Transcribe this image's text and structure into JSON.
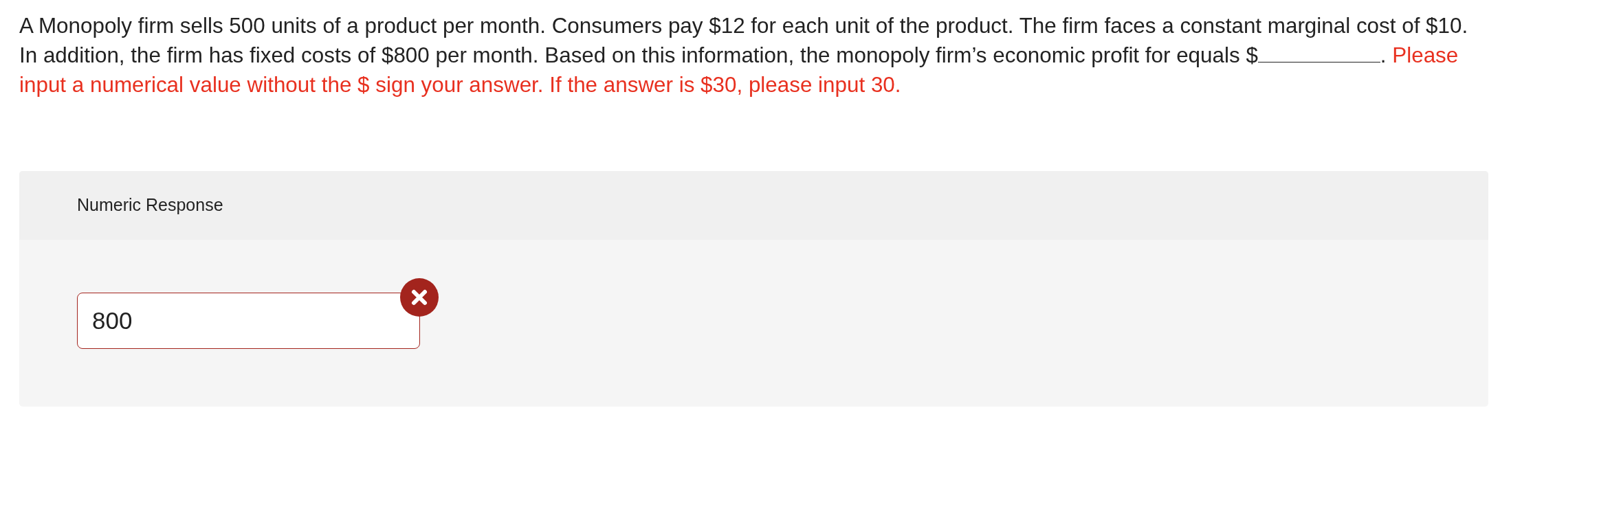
{
  "question": {
    "segments": [
      {
        "kind": "text",
        "text": "A Monopoly firm sells 500 units of a product per month. Consumers pay $12 for each unit of the product. The firm faces a constant marginal cost of $10. In addition, the firm has fixed costs of $800 per month. Based on this information, the monopoly firm’s economic profit for equals $"
      },
      {
        "kind": "blank"
      },
      {
        "kind": "text",
        "text": ". "
      },
      {
        "kind": "note",
        "text": "Please input a numerical value without the $ sign your answer. If the answer is $30, please input 30."
      }
    ]
  },
  "response": {
    "label": "Numeric Response",
    "value": "800",
    "correct": false
  }
}
